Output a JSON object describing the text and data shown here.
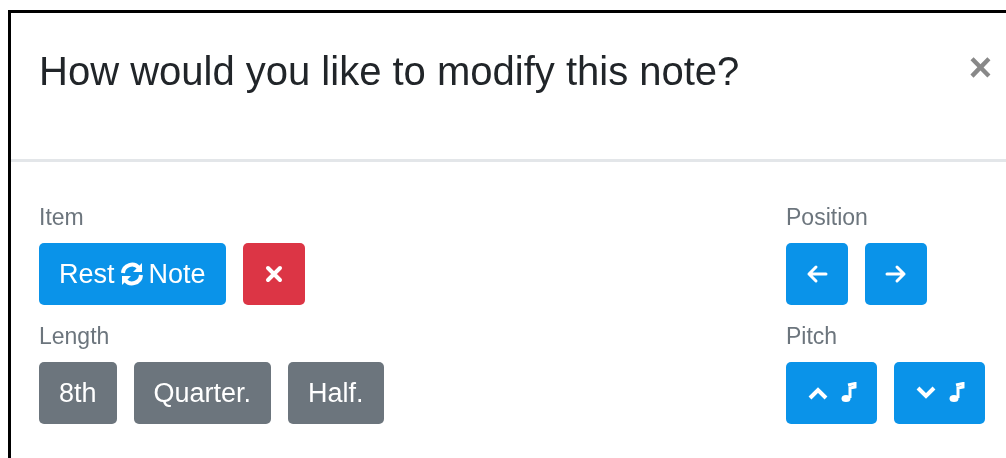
{
  "dialog": {
    "title": "How would you like to modify this note?",
    "close": "×"
  },
  "left_sections": [
    {
      "label": "Item",
      "buttons": [
        {
          "kind": "swap",
          "labels": [
            "Rest",
            "Note"
          ]
        },
        {
          "kind": "delete"
        }
      ]
    },
    {
      "label": "Length",
      "buttons": [
        {
          "kind": "text",
          "label": "8th"
        },
        {
          "kind": "text",
          "label": "Quarter."
        },
        {
          "kind": "text",
          "label": "Half."
        }
      ]
    }
  ],
  "right_sections": [
    {
      "label": "Position",
      "buttons": [
        {
          "kind": "left"
        },
        {
          "kind": "right"
        }
      ]
    },
    {
      "label": "Pitch",
      "buttons": [
        {
          "kind": "pitch-up"
        },
        {
          "kind": "pitch-down"
        }
      ]
    }
  ]
}
